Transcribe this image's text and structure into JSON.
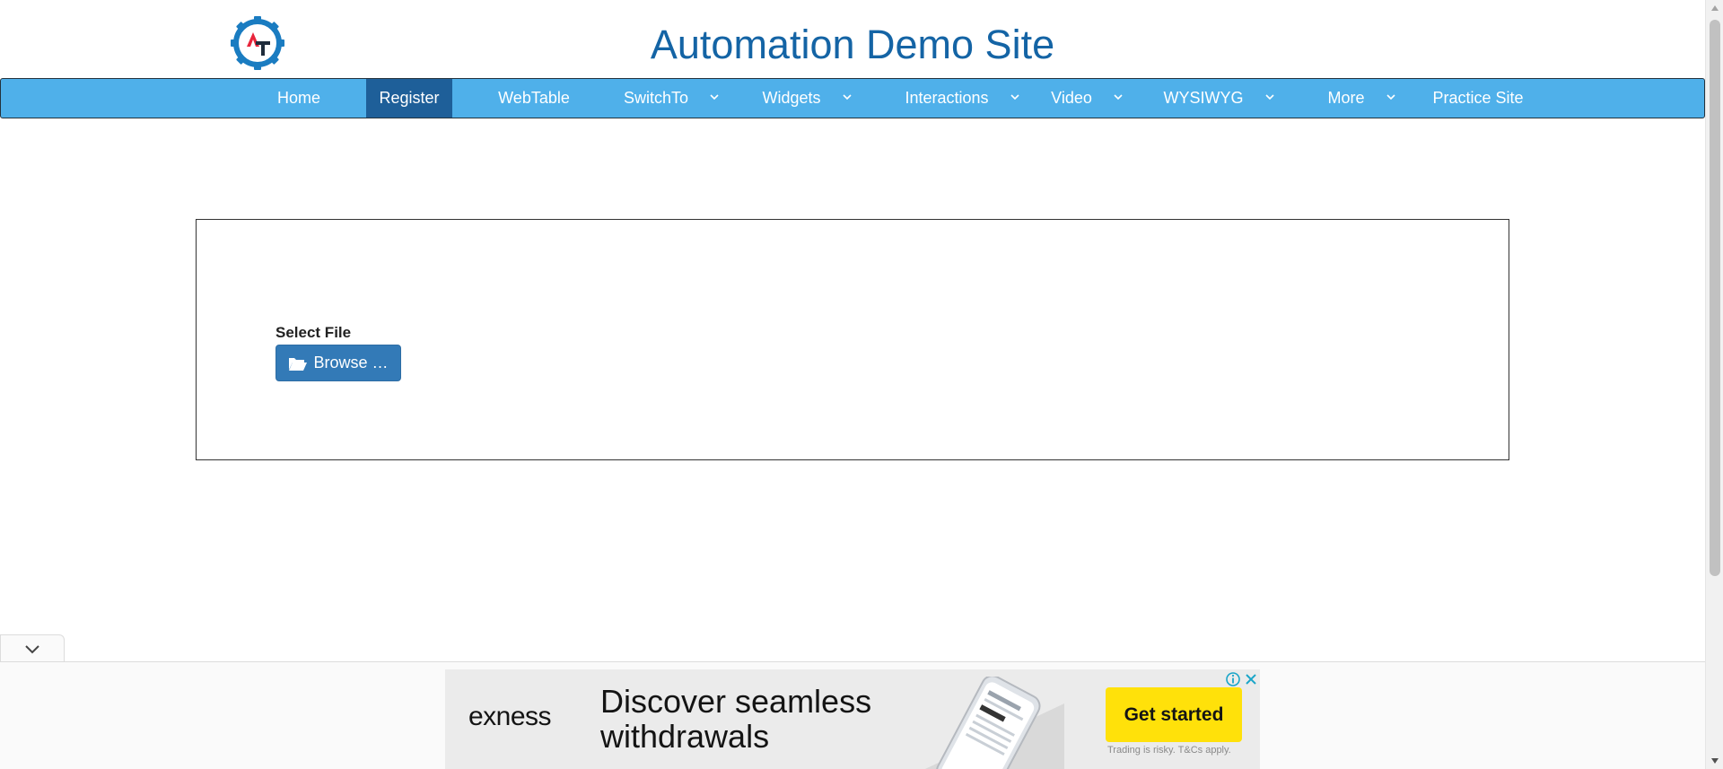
{
  "header": {
    "site_title": "Automation Demo Site",
    "logo_text": "AT"
  },
  "nav": {
    "items": [
      {
        "label": "Home",
        "dropdown": false,
        "active": false
      },
      {
        "label": "Register",
        "dropdown": false,
        "active": true
      },
      {
        "label": "WebTable",
        "dropdown": false,
        "active": false
      },
      {
        "label": "SwitchTo",
        "dropdown": true,
        "active": false
      },
      {
        "label": "Widgets",
        "dropdown": true,
        "active": false
      },
      {
        "label": "Interactions",
        "dropdown": true,
        "active": false
      },
      {
        "label": "Video",
        "dropdown": true,
        "active": false
      },
      {
        "label": "WYSIWYG",
        "dropdown": true,
        "active": false
      },
      {
        "label": "More",
        "dropdown": true,
        "active": false
      },
      {
        "label": "Practice Site",
        "dropdown": false,
        "active": false
      }
    ]
  },
  "upload": {
    "label": "Select File",
    "button_label": "Browse …",
    "button_icon": "folder-open-icon"
  },
  "ad": {
    "brand": "exness",
    "headline_line1": "Discover seamless",
    "headline_line2": "withdrawals",
    "cta": "Get started",
    "disclaimer": "Trading is risky. T&Cs apply."
  },
  "colors": {
    "title": "#1464a5",
    "nav_bg": "#4fb0ea",
    "nav_active": "#1e5f99",
    "button": "#337ab7",
    "ad_cta": "#ffe10a"
  }
}
